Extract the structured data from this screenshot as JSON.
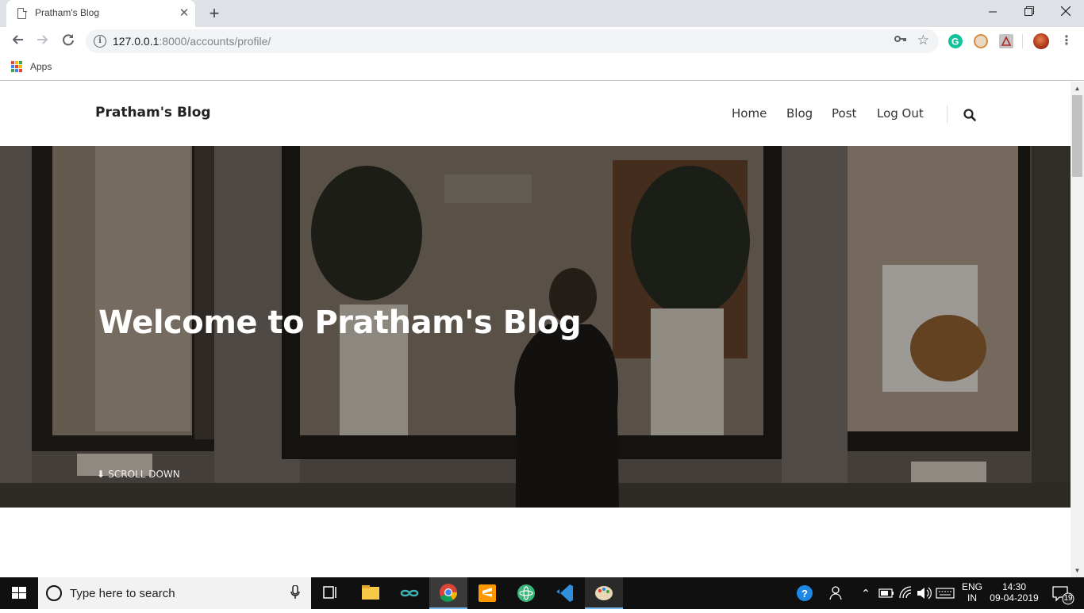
{
  "browser": {
    "tab_title": "Pratham's Blog",
    "tab_close": "✕",
    "new_tab": "+",
    "url_host": "127.0.0.1",
    "url_rest": ":8000/accounts/profile/",
    "bookmarks": {
      "apps_label": "Apps"
    }
  },
  "site": {
    "brand": "Pratham's Blog",
    "nav": [
      "Home",
      "Blog",
      "Post",
      "Log Out"
    ],
    "hero_title": "Welcome to Pratham's Blog",
    "scroll_down": "SCROLL DOWN"
  },
  "taskbar": {
    "search_placeholder": "Type here to search",
    "lang_top": "ENG",
    "lang_bottom": "IN",
    "time": "14:30",
    "date": "09-04-2019",
    "notification_count": "19"
  },
  "colors": {
    "tab_strip": "#dee1e6",
    "taskbar": "#101010",
    "hero_overlay": "#2b2623"
  }
}
